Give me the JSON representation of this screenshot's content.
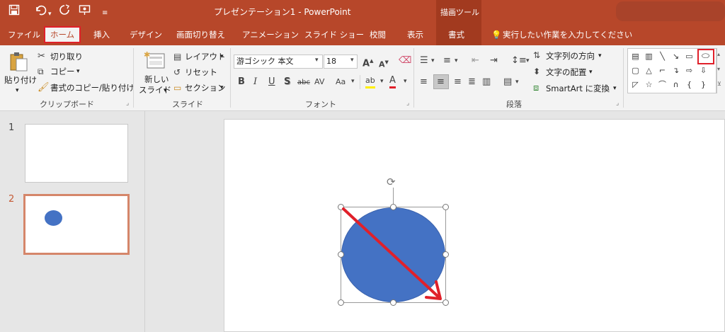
{
  "title_bar": {
    "document_title": "プレゼンテーション1 - PowerPoint",
    "contextual_tab_group": "描画ツール"
  },
  "tabs": [
    "ファイル",
    "ホーム",
    "挿入",
    "デザイン",
    "画面切り替え",
    "アニメーション",
    "スライド ショー",
    "校閲",
    "表示",
    "書式"
  ],
  "tell_me": "実行したい作業を入力してください",
  "ribbon": {
    "clipboard": {
      "paste": "貼り付け",
      "cut": "切り取り",
      "copy": "コピー",
      "format_painter": "書式のコピー/貼り付け",
      "group_label": "クリップボード"
    },
    "slides": {
      "new_slide_line1": "新しい",
      "new_slide_line2": "スライド",
      "layout": "レイアウト",
      "reset": "リセット",
      "section": "セクション",
      "group_label": "スライド"
    },
    "font": {
      "font_name": "游ゴシック 本文",
      "font_size": "18",
      "group_label": "フォント"
    },
    "paragraph": {
      "text_direction": "文字列の方向",
      "align_text": "文字の配置",
      "smartart": "SmartArt に変換",
      "group_label": "段落"
    }
  },
  "thumbnails": [
    {
      "number": "1"
    },
    {
      "number": "2"
    }
  ],
  "colors": {
    "accent": "#b7472a",
    "shape_fill": "#4472c4",
    "annotation_red": "#e0202a"
  }
}
